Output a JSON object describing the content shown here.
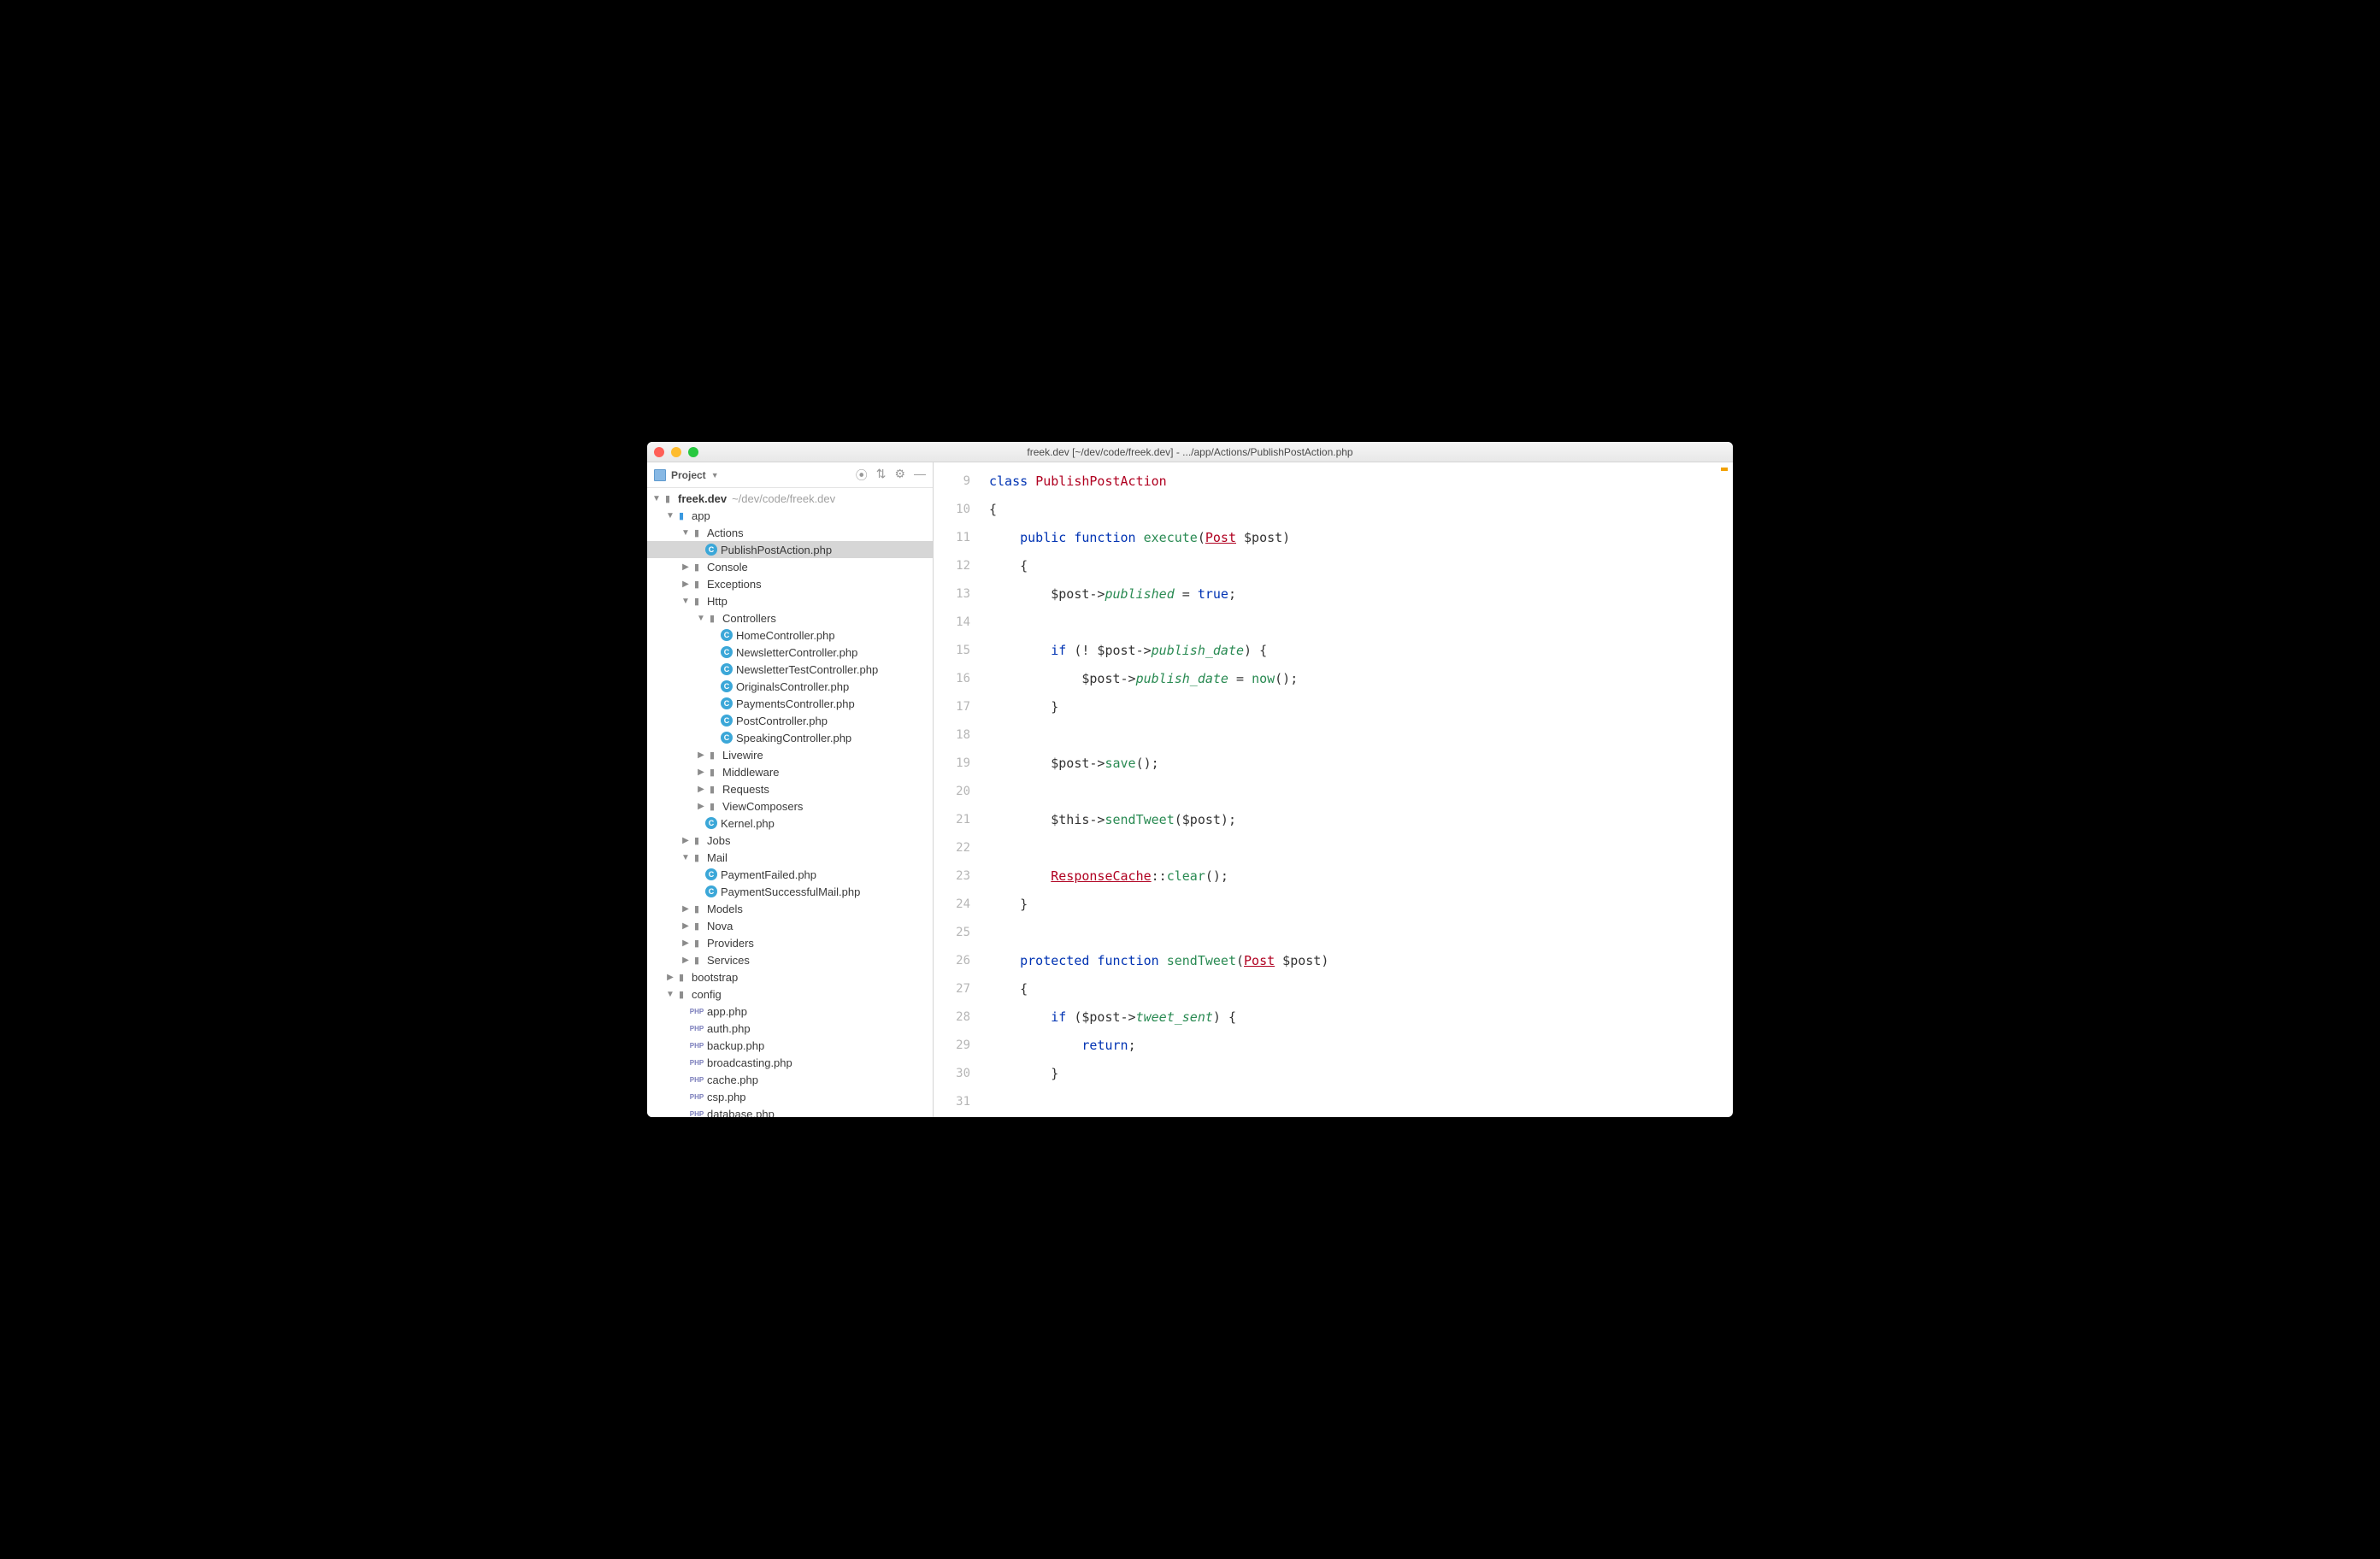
{
  "window": {
    "title": "freek.dev [~/dev/code/freek.dev] - .../app/Actions/PublishPostAction.php"
  },
  "sidebar": {
    "header": "Project",
    "root": {
      "name": "freek.dev",
      "hint": "~/dev/code/freek.dev"
    },
    "tree": [
      {
        "d": 0,
        "exp": true,
        "icon": "blue",
        "name": "app"
      },
      {
        "d": 1,
        "exp": true,
        "icon": "dir",
        "name": "Actions"
      },
      {
        "d": 2,
        "exp": null,
        "icon": "c",
        "name": "PublishPostAction.php",
        "sel": true
      },
      {
        "d": 1,
        "exp": false,
        "icon": "dir",
        "name": "Console"
      },
      {
        "d": 1,
        "exp": false,
        "icon": "dir",
        "name": "Exceptions"
      },
      {
        "d": 1,
        "exp": true,
        "icon": "dir",
        "name": "Http"
      },
      {
        "d": 2,
        "exp": true,
        "icon": "dir",
        "name": "Controllers"
      },
      {
        "d": 3,
        "exp": null,
        "icon": "c",
        "name": "HomeController.php"
      },
      {
        "d": 3,
        "exp": null,
        "icon": "c",
        "name": "NewsletterController.php"
      },
      {
        "d": 3,
        "exp": null,
        "icon": "c",
        "name": "NewsletterTestController.php"
      },
      {
        "d": 3,
        "exp": null,
        "icon": "c",
        "name": "OriginalsController.php"
      },
      {
        "d": 3,
        "exp": null,
        "icon": "c",
        "name": "PaymentsController.php"
      },
      {
        "d": 3,
        "exp": null,
        "icon": "c",
        "name": "PostController.php"
      },
      {
        "d": 3,
        "exp": null,
        "icon": "c",
        "name": "SpeakingController.php"
      },
      {
        "d": 2,
        "exp": false,
        "icon": "dir",
        "name": "Livewire"
      },
      {
        "d": 2,
        "exp": false,
        "icon": "dir",
        "name": "Middleware"
      },
      {
        "d": 2,
        "exp": false,
        "icon": "dir",
        "name": "Requests"
      },
      {
        "d": 2,
        "exp": false,
        "icon": "dir",
        "name": "ViewComposers"
      },
      {
        "d": 2,
        "exp": null,
        "icon": "c",
        "name": "Kernel.php"
      },
      {
        "d": 1,
        "exp": false,
        "icon": "dir",
        "name": "Jobs"
      },
      {
        "d": 1,
        "exp": true,
        "icon": "dir",
        "name": "Mail"
      },
      {
        "d": 2,
        "exp": null,
        "icon": "c",
        "name": "PaymentFailed.php"
      },
      {
        "d": 2,
        "exp": null,
        "icon": "c",
        "name": "PaymentSuccessfulMail.php"
      },
      {
        "d": 1,
        "exp": false,
        "icon": "dir",
        "name": "Models"
      },
      {
        "d": 1,
        "exp": false,
        "icon": "dir",
        "name": "Nova"
      },
      {
        "d": 1,
        "exp": false,
        "icon": "dir",
        "name": "Providers"
      },
      {
        "d": 1,
        "exp": false,
        "icon": "dir",
        "name": "Services"
      },
      {
        "d": 0,
        "exp": false,
        "icon": "dir",
        "name": "bootstrap"
      },
      {
        "d": 0,
        "exp": true,
        "icon": "dir",
        "name": "config"
      },
      {
        "d": 1,
        "exp": null,
        "icon": "php",
        "name": "app.php"
      },
      {
        "d": 1,
        "exp": null,
        "icon": "php",
        "name": "auth.php"
      },
      {
        "d": 1,
        "exp": null,
        "icon": "php",
        "name": "backup.php"
      },
      {
        "d": 1,
        "exp": null,
        "icon": "php",
        "name": "broadcasting.php"
      },
      {
        "d": 1,
        "exp": null,
        "icon": "php",
        "name": "cache.php"
      },
      {
        "d": 1,
        "exp": null,
        "icon": "php",
        "name": "csp.php"
      },
      {
        "d": 1,
        "exp": null,
        "icon": "php",
        "name": "database.php"
      }
    ]
  },
  "editor": {
    "first_line": 9,
    "lines": [
      [
        [
          "kw",
          "class "
        ],
        [
          "cls",
          "PublishPostAction"
        ]
      ],
      [
        [
          "op",
          "{"
        ]
      ],
      [
        [
          "op",
          "    "
        ],
        [
          "kw",
          "public "
        ],
        [
          "kw",
          "function "
        ],
        [
          "fnc",
          "execute"
        ],
        [
          "op",
          "("
        ],
        [
          "type",
          "Post"
        ],
        [
          "op",
          " $post)"
        ]
      ],
      [
        [
          "op",
          "    {"
        ]
      ],
      [
        [
          "op",
          "        $post->"
        ],
        [
          "fn",
          "published"
        ],
        [
          "op",
          " = "
        ],
        [
          "lit",
          "true"
        ],
        [
          "op",
          ";"
        ]
      ],
      [
        [
          "op",
          ""
        ]
      ],
      [
        [
          "op",
          "        "
        ],
        [
          "kw",
          "if"
        ],
        [
          "op",
          " (! $post->"
        ],
        [
          "fn",
          "publish_date"
        ],
        [
          "op",
          ") {"
        ]
      ],
      [
        [
          "op",
          "            $post->"
        ],
        [
          "fn",
          "publish_date"
        ],
        [
          "op",
          " = "
        ],
        [
          "fnc",
          "now"
        ],
        [
          "op",
          "();"
        ]
      ],
      [
        [
          "op",
          "        }"
        ]
      ],
      [
        [
          "op",
          ""
        ]
      ],
      [
        [
          "op",
          "        $post->"
        ],
        [
          "fnc",
          "save"
        ],
        [
          "op",
          "();"
        ]
      ],
      [
        [
          "op",
          ""
        ]
      ],
      [
        [
          "op",
          "        $this->"
        ],
        [
          "fnc",
          "sendTweet"
        ],
        [
          "op",
          "($post);"
        ]
      ],
      [
        [
          "op",
          ""
        ]
      ],
      [
        [
          "op",
          "        "
        ],
        [
          "type",
          "ResponseCache"
        ],
        [
          "op",
          "::"
        ],
        [
          "fnc",
          "clear"
        ],
        [
          "op",
          "();"
        ]
      ],
      [
        [
          "op",
          "    }"
        ]
      ],
      [
        [
          "op",
          ""
        ]
      ],
      [
        [
          "op",
          "    "
        ],
        [
          "kw",
          "protected "
        ],
        [
          "kw",
          "function "
        ],
        [
          "fnc",
          "sendTweet"
        ],
        [
          "op",
          "("
        ],
        [
          "type",
          "Post"
        ],
        [
          "op",
          " $post)"
        ]
      ],
      [
        [
          "op",
          "    {"
        ]
      ],
      [
        [
          "op",
          "        "
        ],
        [
          "kw",
          "if"
        ],
        [
          "op",
          " ($post->"
        ],
        [
          "fn",
          "tweet_sent"
        ],
        [
          "op",
          ") {"
        ]
      ],
      [
        [
          "op",
          "            "
        ],
        [
          "kw",
          "return"
        ],
        [
          "op",
          ";"
        ]
      ],
      [
        [
          "op",
          "        }"
        ]
      ],
      [
        [
          "op",
          ""
        ]
      ]
    ]
  }
}
